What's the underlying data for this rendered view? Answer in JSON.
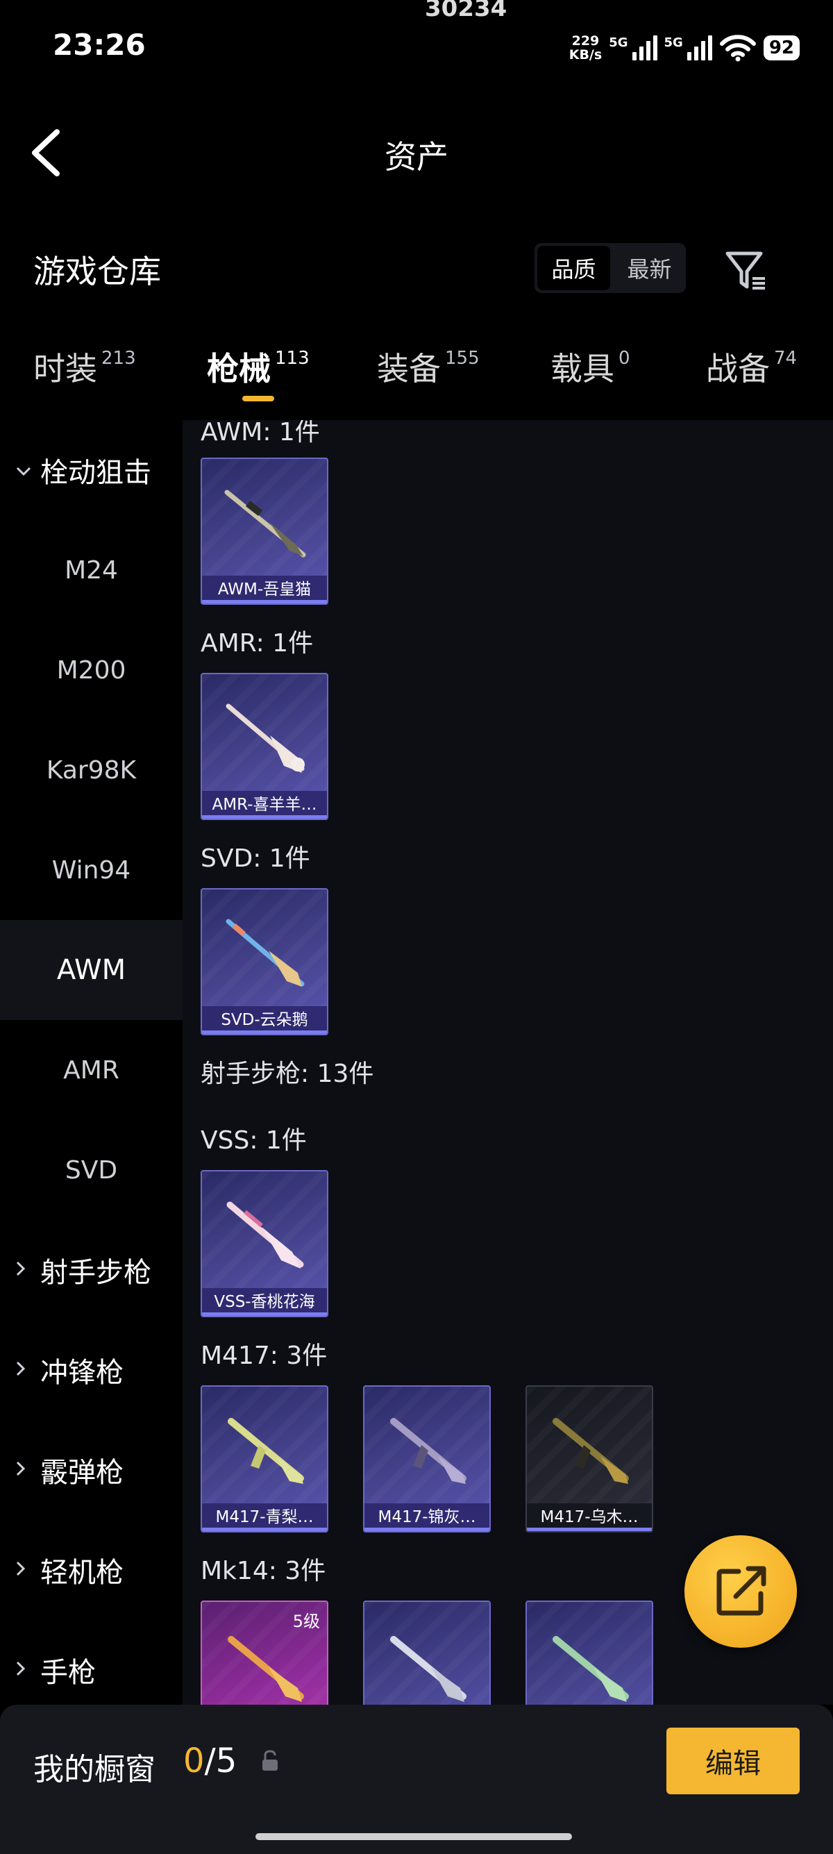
{
  "status_bar": {
    "time": "23:26",
    "top_crop_text": "30234",
    "net_speed_value": "229",
    "net_speed_unit": "KB/s",
    "signal1": "5G",
    "signal2": "5G",
    "battery": "92"
  },
  "header": {
    "title": "资产",
    "section_title": "游戏仓库",
    "sort_options": [
      "品质",
      "最新"
    ],
    "sort_selected": "品质"
  },
  "tabs": [
    {
      "label": "时装",
      "count": "213"
    },
    {
      "label": "枪械",
      "count": "113"
    },
    {
      "label": "装备",
      "count": "155"
    },
    {
      "label": "载具",
      "count": "0"
    },
    {
      "label": "战备",
      "count": "74"
    }
  ],
  "active_tab": "枪械",
  "sidebar": {
    "category_open": "栓动狙击",
    "items": [
      "M24",
      "M200",
      "Kar98K",
      "Win94",
      "AWM",
      "AMR",
      "SVD"
    ],
    "active_item": "AWM",
    "categories": [
      "射手步枪",
      "冲锋枪",
      "霰弹枪",
      "轻机枪",
      "手枪"
    ]
  },
  "groups": [
    {
      "label": "AWM: 1件",
      "items": [
        {
          "name": "AWM-吾皇猫"
        }
      ]
    },
    {
      "label": "AMR: 1件",
      "items": [
        {
          "name": "AMR-喜羊羊…"
        }
      ]
    },
    {
      "label": "SVD: 1件",
      "items": [
        {
          "name": "SVD-云朵鹅"
        }
      ]
    },
    {
      "label": "射手步枪: 13件",
      "items": []
    },
    {
      "label": "VSS: 1件",
      "items": [
        {
          "name": "VSS-香桃花海"
        }
      ]
    },
    {
      "label": "M417: 3件",
      "items": [
        {
          "name": "M417-青梨…"
        },
        {
          "name": "M417-锦灰…"
        },
        {
          "name": "M417-乌木…"
        }
      ]
    },
    {
      "label": "Mk14: 3件",
      "items": [
        {
          "name": "",
          "level": "5级"
        },
        {
          "name": ""
        },
        {
          "name": ""
        }
      ]
    }
  ],
  "showcase": {
    "label": "我的橱窗",
    "current": "0",
    "separator": "/",
    "total": "5",
    "edit_label": "编辑"
  },
  "icons": [
    "back-arrow-icon",
    "filter-icon",
    "chevron-down-icon",
    "chevron-right-icon",
    "share-icon",
    "lock-icon",
    "wifi-icon",
    "signal-icon"
  ],
  "colors": {
    "accent": "#f5b731",
    "card_purple": "#47448f",
    "background": "#000000"
  }
}
